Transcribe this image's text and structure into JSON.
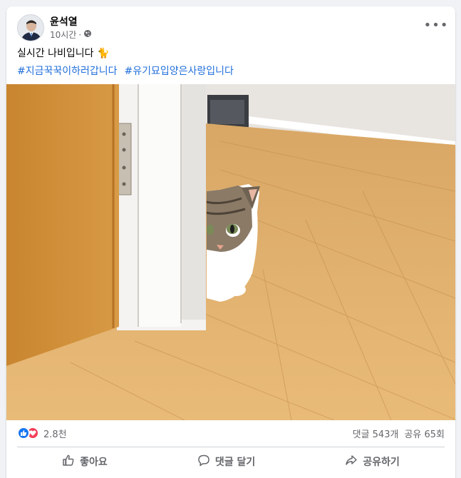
{
  "post": {
    "author": "윤석열",
    "time": "10시간",
    "privacy_icon": "globe-icon",
    "text": "실시간 나비입니다 🐈",
    "hashtags": [
      "#지금꾹꾹이하러갑니다",
      "#유기묘입양은사랑입니다"
    ],
    "photo_icon": "cat-photo"
  },
  "reactions": {
    "count": "2.8천",
    "icons": [
      "like-icon",
      "love-icon"
    ],
    "comments": "댓글 543개",
    "shares": "공유 65회"
  },
  "actions": {
    "like": "좋아요",
    "comment": "댓글 달기",
    "share": "공유하기"
  },
  "colors": {
    "like_blue": "#1877f2",
    "love_red": "#f33e58",
    "hashtag": "#216fdb",
    "secondary_text": "#65676b"
  }
}
